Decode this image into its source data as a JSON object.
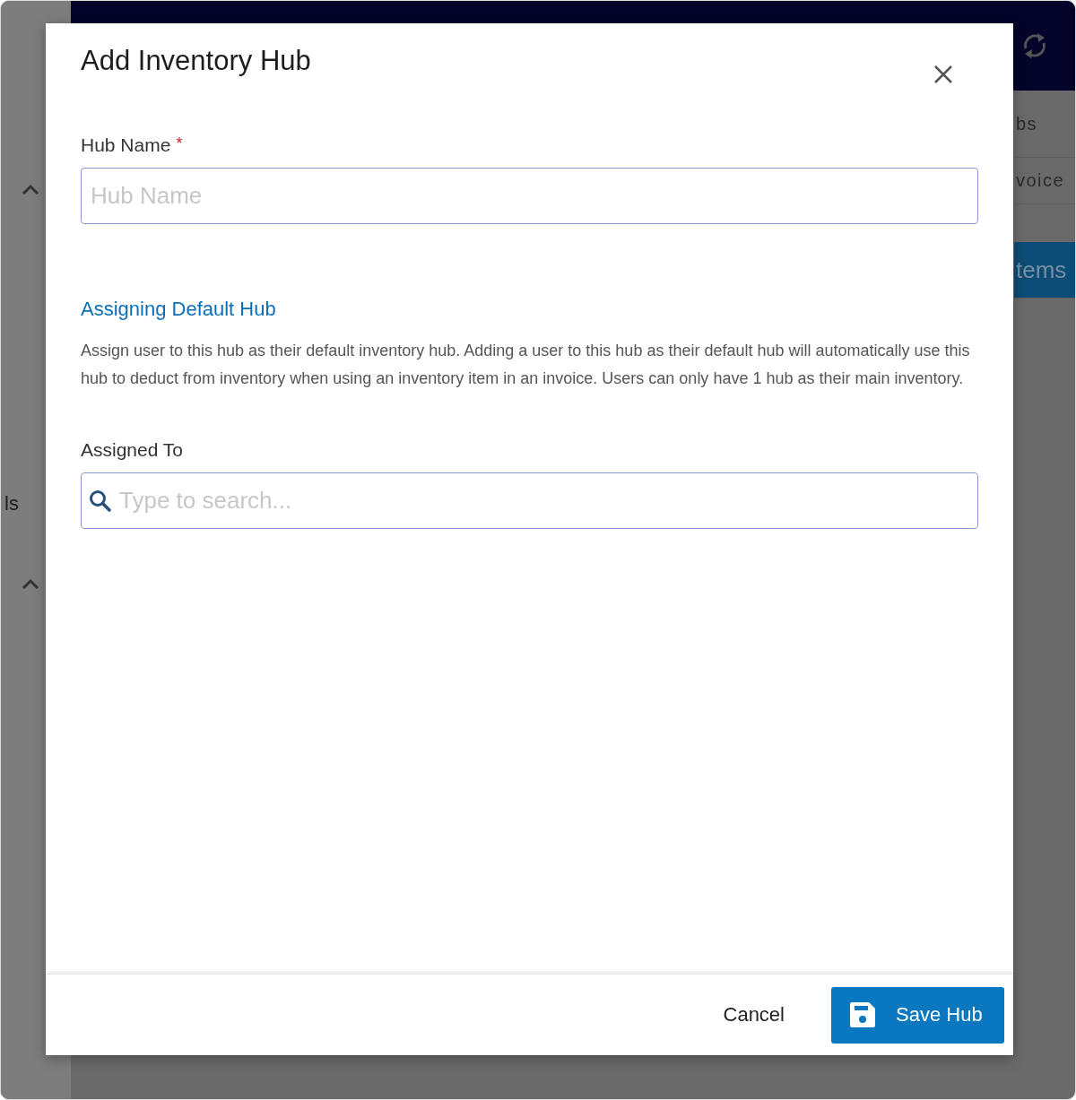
{
  "background": {
    "sidebar_texts": [
      "ls"
    ],
    "right_items": [
      {
        "label": "bs",
        "selected": false
      },
      {
        "label": "voice",
        "selected": false
      },
      {
        "label": "tems",
        "selected": true
      }
    ]
  },
  "dialog": {
    "title": "Add Inventory Hub",
    "fields": [
      {
        "kind": "text",
        "label": "Hub Name",
        "required": true,
        "required_mark": "*",
        "placeholder": "Hub Name"
      }
    ],
    "section": {
      "heading": "Assigning Default Hub",
      "description": "Assign user to this hub as their default inventory hub. Adding a user to this hub as their default hub will automatically use this hub to deduct from inventory when using an inventory item in an invoice. Users can only have 1 hub as their main inventory."
    },
    "assign_field": {
      "kind": "search",
      "label": "Assigned To",
      "placeholder": "Type to search..."
    },
    "buttons": [
      {
        "kind": "text",
        "label": "Cancel"
      },
      {
        "kind": "primary",
        "label": "Save Hub"
      }
    ]
  }
}
